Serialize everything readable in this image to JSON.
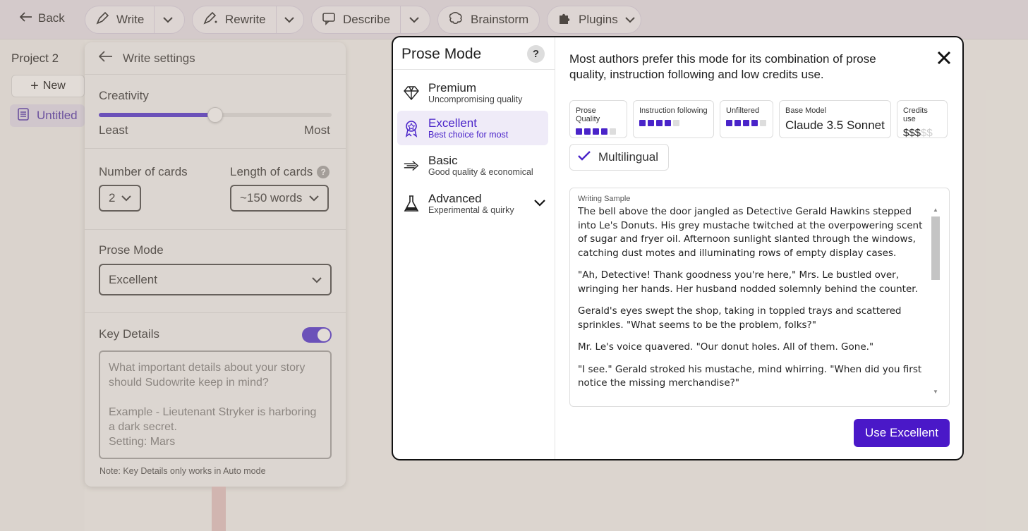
{
  "topbar": {
    "back_label": "Back",
    "tools": [
      {
        "label": "Write"
      },
      {
        "label": "Rewrite"
      },
      {
        "label": "Describe"
      },
      {
        "label": "Brainstorm"
      },
      {
        "label": "Plugins"
      }
    ]
  },
  "sidebar": {
    "project_name": "Project 2",
    "new_label": "New",
    "doc_label": "Untitled"
  },
  "settings": {
    "title": "Write settings",
    "creativity_label": "Creativity",
    "creativity_level": 0.5,
    "least_label": "Least",
    "most_label": "Most",
    "cards_label": "Number of cards",
    "cards_value": "2",
    "length_label": "Length of cards",
    "length_value": "~150 words",
    "prose_label": "Prose Mode",
    "prose_value": "Excellent",
    "key_details_label": "Key Details",
    "key_details_enabled": true,
    "key_details_placeholder": "What important details about your story should Sudowrite keep in mind?\n\nExample - Lieutenant Stryker is harboring a dark secret.\nSetting: Mars",
    "note": "Note: Key Details only works in Auto mode"
  },
  "modal": {
    "title": "Prose Mode",
    "help": "?",
    "modes": [
      {
        "name": "Premium",
        "sub": "Uncompromising quality",
        "icon": "diamond-icon",
        "active": false
      },
      {
        "name": "Excellent",
        "sub": "Best choice for most",
        "icon": "award-ribbon-icon",
        "active": true
      },
      {
        "name": "Basic",
        "sub": "Good quality & economical",
        "icon": "fast-arrow-icon",
        "active": false
      },
      {
        "name": "Advanced",
        "sub": "Experimental & quirky",
        "icon": "flask-icon",
        "active": false
      }
    ],
    "description": "Most authors prefer this mode for its combination of prose quality, instruction following and low credits use.",
    "stats": {
      "prose_quality_label": "Prose Quality",
      "prose_quality_level": 4,
      "instruction_label": "Instruction following",
      "instruction_level": 4,
      "unfiltered_label": "Unfiltered",
      "unfiltered_level": 4,
      "base_model_label": "Base Model",
      "base_model_value": "Claude 3.5 Sonnet",
      "credits_label": "Credits use",
      "credits_on": "$$$",
      "credits_off": "$$"
    },
    "multilingual_label": "Multilingual",
    "sample_label": "Writing Sample",
    "sample_paragraphs": [
      "The bell above the door jangled as Detective Gerald Hawkins stepped into Le's Donuts. His grey mustache twitched at the overpowering scent of sugar and fryer oil. Afternoon sunlight slanted through the windows, catching dust motes and illuminating rows of empty display cases.",
      "\"Ah, Detective! Thank goodness you're here,\" Mrs. Le bustled over, wringing her hands. Her husband nodded solemnly behind the counter.",
      "Gerald's eyes swept the shop, taking in toppled trays and scattered sprinkles. \"What seems to be the problem, folks?\"",
      "Mr. Le's voice quavered. \"Our donut holes. All of them. Gone.\"",
      "\"I see.\" Gerald stroked his mustache, mind whirring. \"When did you first notice the missing merchandise?\""
    ],
    "use_button": "Use Excellent"
  },
  "colors": {
    "accent": "#4a18c8",
    "active_bg": "#efebf8"
  }
}
